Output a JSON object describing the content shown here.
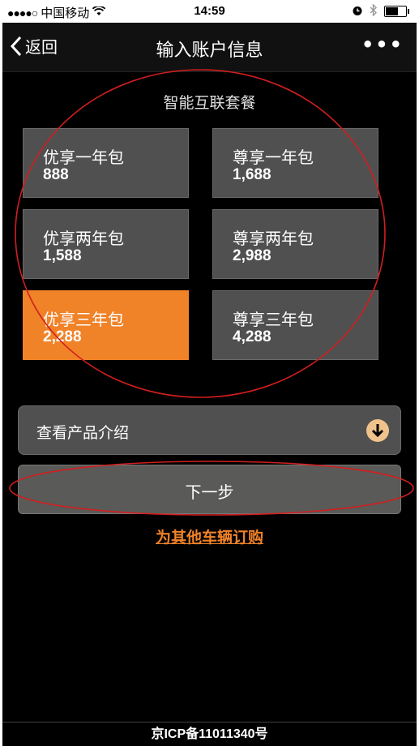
{
  "status_bar": {
    "signal_dots": "●●●●○",
    "carrier": "中国移动",
    "wifi_icon": "wifi-icon",
    "time": "14:59",
    "alarm_icon": "alarm-icon",
    "bluetooth_icon": "bluetooth-icon",
    "battery_icon": "battery-icon"
  },
  "nav": {
    "back_label": "返回",
    "title": "输入账户信息",
    "more_label": "•••"
  },
  "section_title": "智能互联套餐",
  "packages": [
    {
      "name": "优享一年包",
      "price": "888",
      "selected": false
    },
    {
      "name": "尊享一年包",
      "price": "1,688",
      "selected": false
    },
    {
      "name": "优享两年包",
      "price": "1,588",
      "selected": false
    },
    {
      "name": "尊享两年包",
      "price": "2,988",
      "selected": false
    },
    {
      "name": "优享三年包",
      "price": "2,288",
      "selected": true
    },
    {
      "name": "尊享三年包",
      "price": "4,288",
      "selected": false
    }
  ],
  "intro_dropdown": {
    "label": "查看产品介绍"
  },
  "next_button": {
    "label": "下一步"
  },
  "other_vehicle_link": "为其他车辆订购",
  "footer": "京ICP备11011340号",
  "colors": {
    "accent": "#f08228",
    "card": "#505050",
    "annotation": "#d21e1e"
  }
}
